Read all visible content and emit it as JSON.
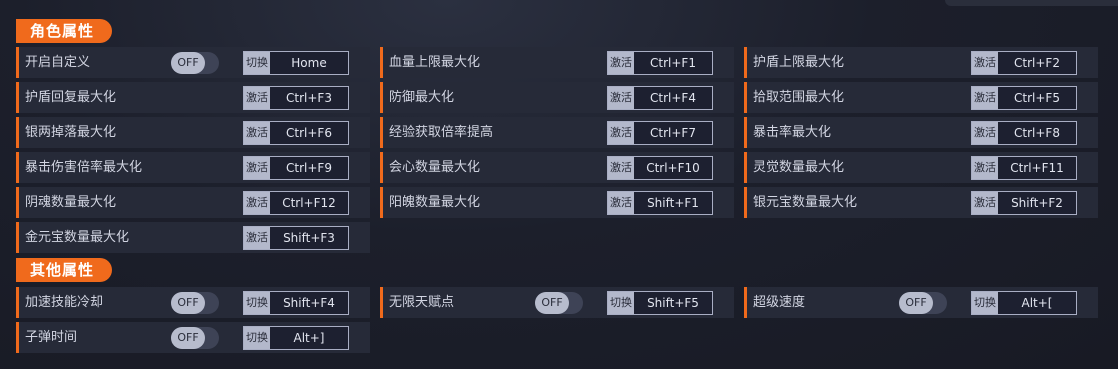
{
  "sections": {
    "character": "角色属性",
    "other": "其他属性"
  },
  "verbs": {
    "toggle": "切换",
    "activate": "激活"
  },
  "toggle_state": "OFF",
  "rows": {
    "custom": {
      "label": "开启自定义",
      "key": "Home"
    },
    "hp_max": {
      "label": "血量上限最大化",
      "key": "Ctrl+F1"
    },
    "shield_max": {
      "label": "护盾上限最大化",
      "key": "Ctrl+F2"
    },
    "shield_regen": {
      "label": "护盾回复最大化",
      "key": "Ctrl+F3"
    },
    "defense": {
      "label": "防御最大化",
      "key": "Ctrl+F4"
    },
    "pickup": {
      "label": "拾取范围最大化",
      "key": "Ctrl+F5"
    },
    "silver_drop": {
      "label": "银两掉落最大化",
      "key": "Ctrl+F6"
    },
    "exp_rate": {
      "label": "经验获取倍率提高",
      "key": "Ctrl+F7"
    },
    "crit_rate": {
      "label": "暴击率最大化",
      "key": "Ctrl+F8"
    },
    "crit_dmg": {
      "label": "暴击伤害倍率最大化",
      "key": "Ctrl+F9"
    },
    "huixin": {
      "label": "会心数量最大化",
      "key": "Ctrl+F10"
    },
    "lingjue": {
      "label": "灵觉数量最大化",
      "key": "Ctrl+F11"
    },
    "yinpo": {
      "label": "阴魂数量最大化",
      "key": "Ctrl+F12"
    },
    "yangpo": {
      "label": "阳魄数量最大化",
      "key": "Shift+F1"
    },
    "silver_ingot": {
      "label": "银元宝数量最大化",
      "key": "Shift+F2"
    },
    "gold_ingot": {
      "label": "金元宝数量最大化",
      "key": "Shift+F3"
    },
    "skill_cd": {
      "label": "加速技能冷却",
      "key": "Shift+F4"
    },
    "talent": {
      "label": "无限天赋点",
      "key": "Shift+F5"
    },
    "speed": {
      "label": "超级速度",
      "key": "Alt+["
    },
    "bullet_time": {
      "label": "子弹时间",
      "key": "Alt+]"
    }
  }
}
